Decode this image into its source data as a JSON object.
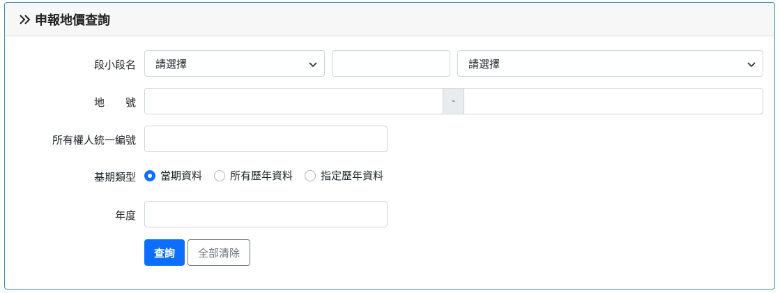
{
  "panel": {
    "title": "申報地價查詢",
    "icon": "double-chevron-right-icon"
  },
  "section": {
    "label": "段小段名",
    "select1_value": "請選擇",
    "text_value": "",
    "select2_value": "請選擇"
  },
  "land_number": {
    "label": "地　　號",
    "main_value": "",
    "separator": "-",
    "sub_value": ""
  },
  "owner_id": {
    "label": "所有權人統一編號",
    "value": ""
  },
  "period_type": {
    "label": "基期類型",
    "options": [
      {
        "label": "當期資料",
        "checked": true
      },
      {
        "label": "所有歷年資料",
        "checked": false
      },
      {
        "label": "指定歷年資料",
        "checked": false
      }
    ]
  },
  "year": {
    "label": "年度",
    "value": ""
  },
  "actions": {
    "query_label": "查詢",
    "clear_label": "全部清除"
  },
  "colors": {
    "primary": "#0d6efd",
    "border_accent": "#3a8fa0"
  }
}
